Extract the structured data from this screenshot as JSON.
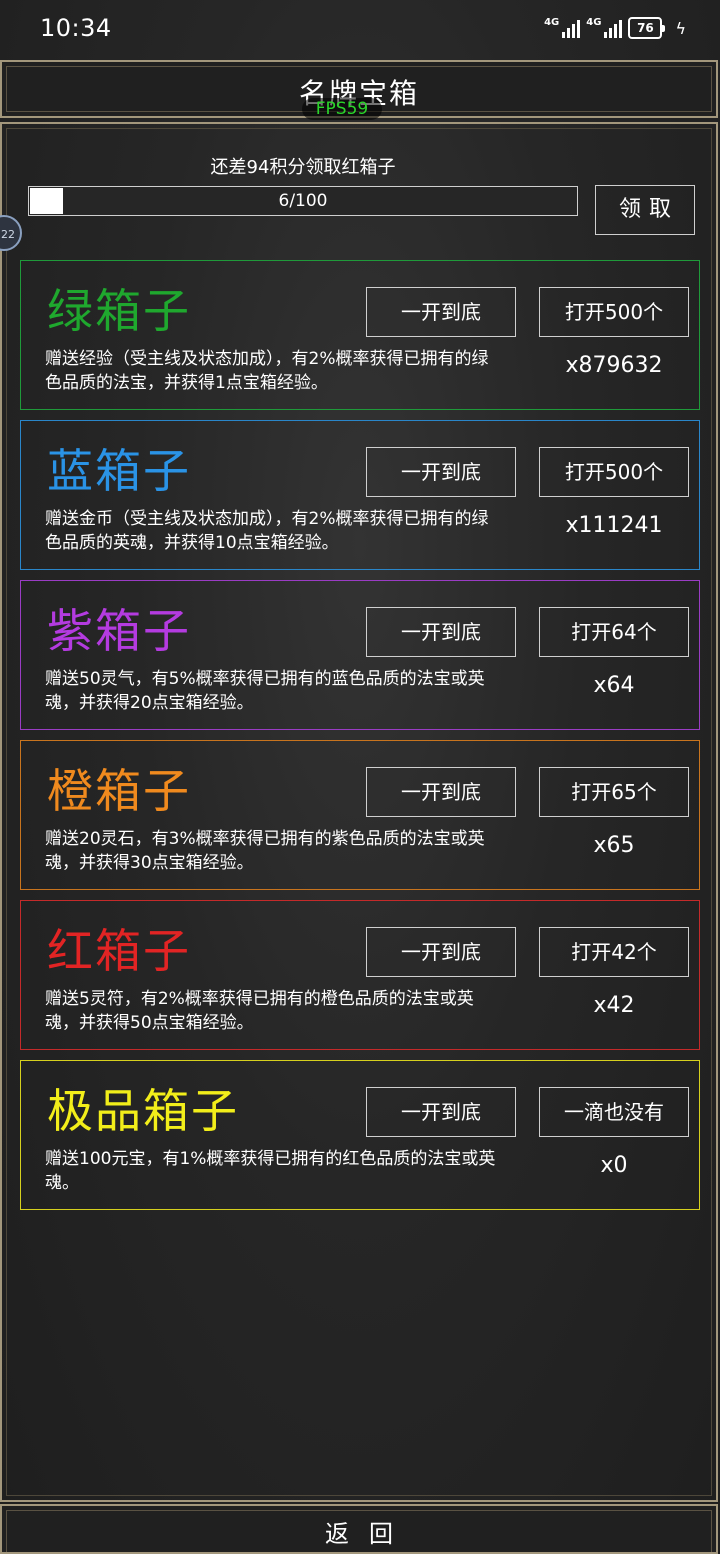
{
  "status_bar": {
    "time": "10:34",
    "network_1": "4G",
    "network_2": "4G",
    "battery": "76"
  },
  "header": {
    "title": "名牌宝箱",
    "fps": "FPS59"
  },
  "floating_ball": {
    "label": "22"
  },
  "progress": {
    "points_text": "还差94积分领取红箱子",
    "label": "6/100",
    "value": 6,
    "max": 100,
    "claim_label": "领取"
  },
  "boxes": [
    {
      "name": "绿箱子",
      "color": "#1fa82e",
      "border": "#1f9a3a",
      "desc": "赠送经验（受主线及状态加成），有2%概率获得已拥有的绿色品质的法宝，并获得1点宝箱经验。",
      "open_all_label": "一开到底",
      "open_label": "打开500个",
      "count": "x879632"
    },
    {
      "name": "蓝箱子",
      "color": "#2a93e6",
      "border": "#2a86c9",
      "desc": "赠送金币（受主线及状态加成），有2%概率获得已拥有的绿色品质的英魂，并获得10点宝箱经验。",
      "open_all_label": "一开到底",
      "open_label": "打开500个",
      "count": "x111241"
    },
    {
      "name": "紫箱子",
      "color": "#b43be0",
      "border": "#9a3cc4",
      "desc": "赠送50灵气，有5%概率获得已拥有的蓝色品质的法宝或英魂，并获得20点宝箱经验。",
      "open_all_label": "一开到底",
      "open_label": "打开64个",
      "count": "x64"
    },
    {
      "name": "橙箱子",
      "color": "#f08a1e",
      "border": "#c8741e",
      "desc": "赠送20灵石，有3%概率获得已拥有的紫色品质的法宝或英魂，并获得30点宝箱经验。",
      "open_all_label": "一开到底",
      "open_label": "打开65个",
      "count": "x65"
    },
    {
      "name": "红箱子",
      "color": "#e22424",
      "border": "#c42a2a",
      "desc": "赠送5灵符，有2%概率获得已拥有的橙色品质的法宝或英魂，并获得50点宝箱经验。",
      "open_all_label": "一开到底",
      "open_label": "打开42个",
      "count": "x42"
    },
    {
      "name": "极品箱子",
      "color": "#f2ee1a",
      "border": "#d6d01e",
      "desc": "赠送100元宝，有1%概率获得已拥有的红色品质的法宝或英魂。",
      "open_all_label": "一开到底",
      "open_label": "一滴也没有",
      "count": "x0"
    }
  ],
  "footer": {
    "back_label": "返回"
  }
}
